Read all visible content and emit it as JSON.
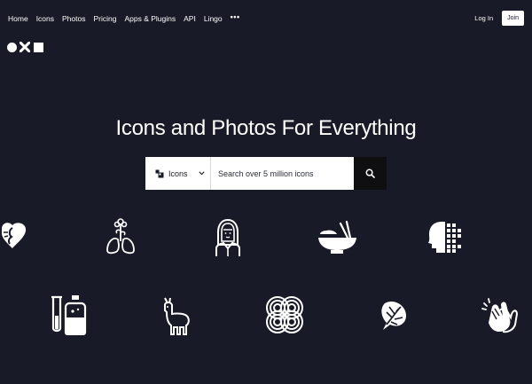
{
  "nav": {
    "links": [
      "Home",
      "Icons",
      "Photos",
      "Pricing",
      "Apps & Plugins",
      "API",
      "Lingo"
    ],
    "more": "•••",
    "login": "Log In",
    "join": "Join"
  },
  "logo": {
    "icon": "noun-project-logo"
  },
  "hero": {
    "title": "Icons and Photos For Everything"
  },
  "search": {
    "type_label": "Icons",
    "placeholder": "Search over 5 million icons",
    "icon": "search-icon"
  },
  "showcase_icons": [
    "heart-face-icon",
    "lungs-flower-icon",
    "woman-hijab-icon",
    "ramen-bowl-icon",
    "pixel-head-icon",
    "test-tube-bottle-icon",
    "llama-icon",
    "spiral-knot-icon",
    "monstera-leaf-icon",
    "clapping-hands-icon"
  ],
  "colors": {
    "background": "#181a27",
    "foreground": "#ffffff",
    "search_button": "#0f0f12"
  }
}
